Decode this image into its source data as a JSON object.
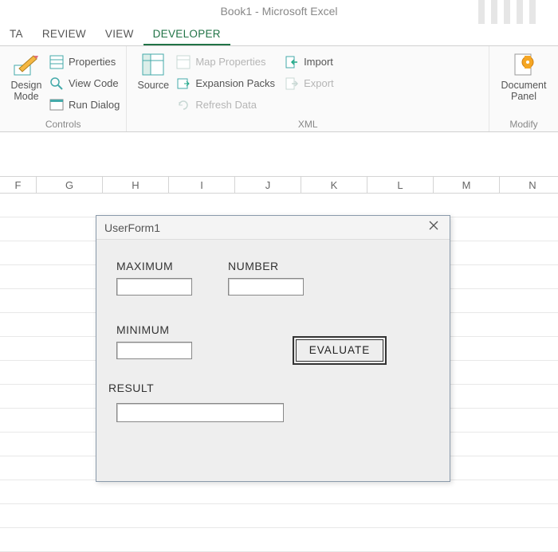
{
  "app_title": "Book1 - Microsoft Excel",
  "tabs": {
    "data": "TA",
    "review": "REVIEW",
    "view": "VIEW",
    "developer": "DEVELOPER"
  },
  "ribbon": {
    "controls": {
      "design_mode": "Design\nMode",
      "properties": "Properties",
      "view_code": "View Code",
      "run_dialog": "Run Dialog",
      "group": "Controls"
    },
    "xml": {
      "source": "Source",
      "map_properties": "Map Properties",
      "expansion_packs": "Expansion Packs",
      "refresh_data": "Refresh Data",
      "import": "Import",
      "export": "Export",
      "group": "XML"
    },
    "modify": {
      "document_panel": "Document\nPanel",
      "group": "Modify"
    }
  },
  "columns": [
    "F",
    "G",
    "H",
    "I",
    "J",
    "K",
    "L",
    "M",
    "N"
  ],
  "form": {
    "title": "UserForm1",
    "labels": {
      "maximum": "MAXIMUM",
      "minimum": "MINIMUM",
      "number": "NUMBER",
      "result": "RESULT"
    },
    "button": "EVALUATE",
    "values": {
      "maximum": "",
      "minimum": "",
      "number": "",
      "result": ""
    }
  }
}
